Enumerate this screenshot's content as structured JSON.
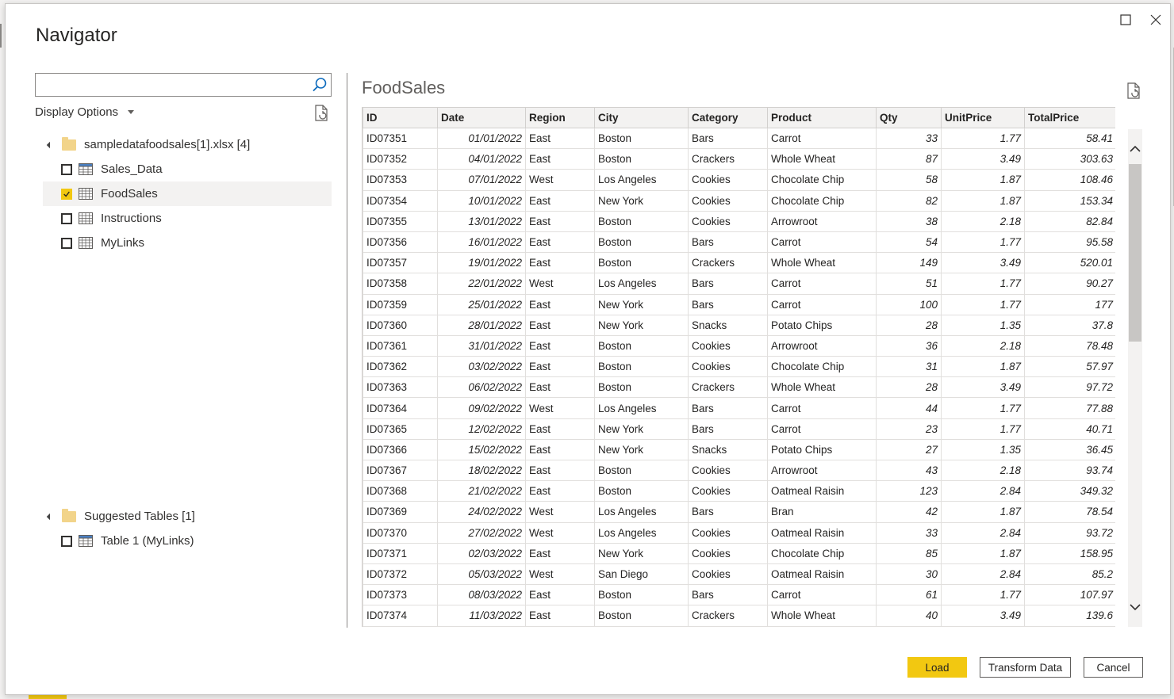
{
  "dialog": {
    "title": "Navigator"
  },
  "left_pane": {
    "search_placeholder": "",
    "display_options_label": "Display Options",
    "tree": {
      "root_label": "sampledatafoodsales[1].xlsx [4]",
      "items": [
        {
          "label": "Sales_Data",
          "checked": false,
          "icon": "table-icon"
        },
        {
          "label": "FoodSales",
          "checked": true,
          "icon": "sheet-icon"
        },
        {
          "label": "Instructions",
          "checked": false,
          "icon": "sheet-icon"
        },
        {
          "label": "MyLinks",
          "checked": false,
          "icon": "sheet-icon"
        }
      ]
    },
    "suggested": {
      "root_label": "Suggested Tables [1]",
      "items": [
        {
          "label": "Table 1 (MyLinks)",
          "checked": false,
          "icon": "table-icon"
        }
      ]
    }
  },
  "preview": {
    "title": "FoodSales",
    "columns": [
      "ID",
      "Date",
      "Region",
      "City",
      "Category",
      "Product",
      "Qty",
      "UnitPrice",
      "TotalPrice"
    ],
    "rows": [
      [
        "ID07351",
        "01/01/2022",
        "East",
        "Boston",
        "Bars",
        "Carrot",
        "33",
        "1.77",
        "58.41"
      ],
      [
        "ID07352",
        "04/01/2022",
        "East",
        "Boston",
        "Crackers",
        "Whole Wheat",
        "87",
        "3.49",
        "303.63"
      ],
      [
        "ID07353",
        "07/01/2022",
        "West",
        "Los Angeles",
        "Cookies",
        "Chocolate Chip",
        "58",
        "1.87",
        "108.46"
      ],
      [
        "ID07354",
        "10/01/2022",
        "East",
        "New York",
        "Cookies",
        "Chocolate Chip",
        "82",
        "1.87",
        "153.34"
      ],
      [
        "ID07355",
        "13/01/2022",
        "East",
        "Boston",
        "Cookies",
        "Arrowroot",
        "38",
        "2.18",
        "82.84"
      ],
      [
        "ID07356",
        "16/01/2022",
        "East",
        "Boston",
        "Bars",
        "Carrot",
        "54",
        "1.77",
        "95.58"
      ],
      [
        "ID07357",
        "19/01/2022",
        "East",
        "Boston",
        "Crackers",
        "Whole Wheat",
        "149",
        "3.49",
        "520.01"
      ],
      [
        "ID07358",
        "22/01/2022",
        "West",
        "Los Angeles",
        "Bars",
        "Carrot",
        "51",
        "1.77",
        "90.27"
      ],
      [
        "ID07359",
        "25/01/2022",
        "East",
        "New York",
        "Bars",
        "Carrot",
        "100",
        "1.77",
        "177"
      ],
      [
        "ID07360",
        "28/01/2022",
        "East",
        "New York",
        "Snacks",
        "Potato Chips",
        "28",
        "1.35",
        "37.8"
      ],
      [
        "ID07361",
        "31/01/2022",
        "East",
        "Boston",
        "Cookies",
        "Arrowroot",
        "36",
        "2.18",
        "78.48"
      ],
      [
        "ID07362",
        "03/02/2022",
        "East",
        "Boston",
        "Cookies",
        "Chocolate Chip",
        "31",
        "1.87",
        "57.97"
      ],
      [
        "ID07363",
        "06/02/2022",
        "East",
        "Boston",
        "Crackers",
        "Whole Wheat",
        "28",
        "3.49",
        "97.72"
      ],
      [
        "ID07364",
        "09/02/2022",
        "West",
        "Los Angeles",
        "Bars",
        "Carrot",
        "44",
        "1.77",
        "77.88"
      ],
      [
        "ID07365",
        "12/02/2022",
        "East",
        "New York",
        "Bars",
        "Carrot",
        "23",
        "1.77",
        "40.71"
      ],
      [
        "ID07366",
        "15/02/2022",
        "East",
        "New York",
        "Snacks",
        "Potato Chips",
        "27",
        "1.35",
        "36.45"
      ],
      [
        "ID07367",
        "18/02/2022",
        "East",
        "Boston",
        "Cookies",
        "Arrowroot",
        "43",
        "2.18",
        "93.74"
      ],
      [
        "ID07368",
        "21/02/2022",
        "East",
        "Boston",
        "Cookies",
        "Oatmeal Raisin",
        "123",
        "2.84",
        "349.32"
      ],
      [
        "ID07369",
        "24/02/2022",
        "West",
        "Los Angeles",
        "Bars",
        "Bran",
        "42",
        "1.87",
        "78.54"
      ],
      [
        "ID07370",
        "27/02/2022",
        "West",
        "Los Angeles",
        "Cookies",
        "Oatmeal Raisin",
        "33",
        "2.84",
        "93.72"
      ],
      [
        "ID07371",
        "02/03/2022",
        "East",
        "New York",
        "Cookies",
        "Chocolate Chip",
        "85",
        "1.87",
        "158.95"
      ],
      [
        "ID07372",
        "05/03/2022",
        "West",
        "San Diego",
        "Cookies",
        "Oatmeal Raisin",
        "30",
        "2.84",
        "85.2"
      ],
      [
        "ID07373",
        "08/03/2022",
        "East",
        "Boston",
        "Bars",
        "Carrot",
        "61",
        "1.77",
        "107.97"
      ],
      [
        "ID07374",
        "11/03/2022",
        "East",
        "Boston",
        "Crackers",
        "Whole Wheat",
        "40",
        "3.49",
        "139.6"
      ]
    ]
  },
  "footer": {
    "load_label": "Load",
    "transform_label": "Transform Data",
    "cancel_label": "Cancel"
  },
  "colors": {
    "accent": "#f2c811",
    "folder": "#f2d48a",
    "border": "#8a8886"
  }
}
